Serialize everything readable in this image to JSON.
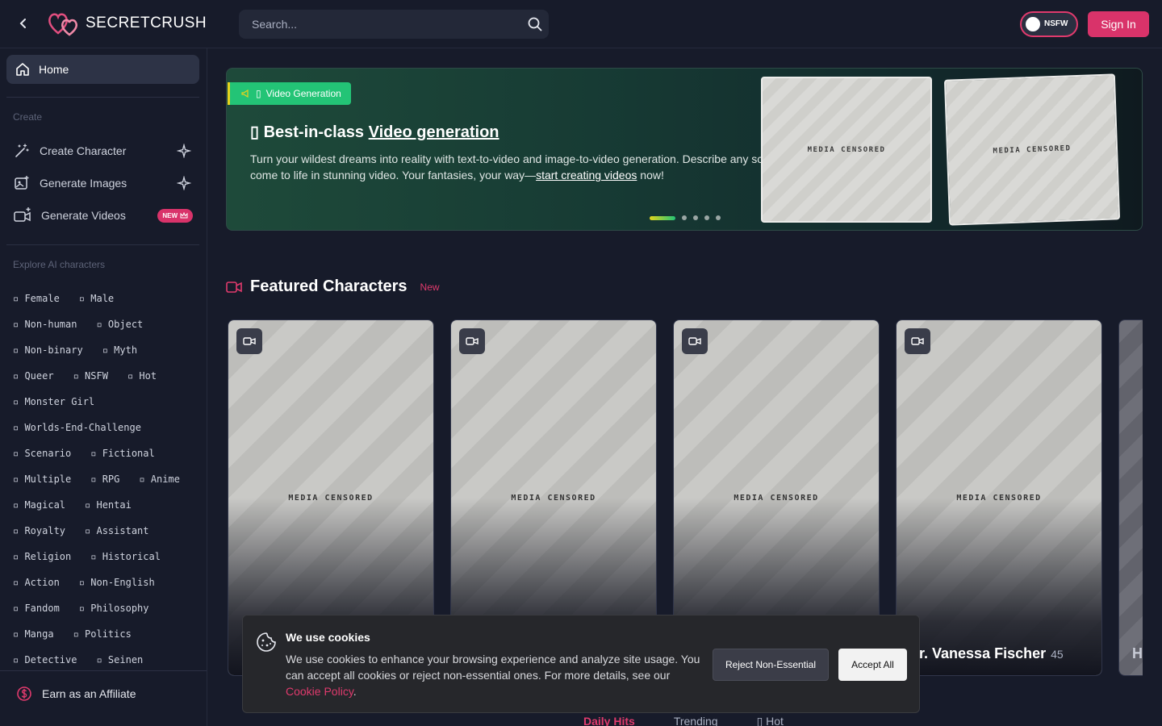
{
  "header": {
    "logo_text": "SECRETCRUSH",
    "search_placeholder": "Search...",
    "nsfw_label": "NSFW",
    "sign_in": "Sign In"
  },
  "sidebar": {
    "home": "Home",
    "create_label": "Create",
    "create_items": [
      {
        "label": "Create Character"
      },
      {
        "label": "Generate Images"
      },
      {
        "label": "Generate Videos",
        "badge": "NEW"
      }
    ],
    "explore_label": "Explore AI characters",
    "tag_rows": [
      [
        "Female",
        "Male"
      ],
      [
        "Non-human",
        "Object"
      ],
      [
        "Non-binary",
        "Myth"
      ],
      [
        "Queer",
        "NSFW",
        "Hot"
      ],
      [
        "Monster Girl"
      ],
      [
        "Worlds-End-Challenge"
      ],
      [
        "Scenario",
        "Fictional"
      ],
      [
        "Multiple",
        "RPG",
        "Anime"
      ],
      [
        "Magical",
        "Hentai"
      ],
      [
        "Royalty",
        "Assistant"
      ],
      [
        "Religion",
        "Historical"
      ],
      [
        "Action",
        "Non-English"
      ],
      [
        "Fandom",
        "Philosophy"
      ],
      [
        "Manga",
        "Politics"
      ],
      [
        "Detective",
        "Seinen"
      ]
    ],
    "affiliate": "Earn as an Affiliate"
  },
  "banner": {
    "tag": "Video Generation",
    "title_prefix": "Best-in-class ",
    "title_link": "Video generation",
    "desc_1": "Turn your wildest dreams into reality with text-to-video and image-to-video generation. Describe any scene and watch it",
    "desc_2": "come to life in stunning video. Your fantasies, your way—",
    "desc_link": "start creating videos",
    "desc_3": " now!",
    "media_label": "MEDIA CENSORED",
    "slide_count": 5,
    "active_slide": 0
  },
  "featured": {
    "title": "Featured Characters",
    "badge": "New",
    "cards": [
      {
        "media": "MEDIA CENSORED"
      },
      {
        "media": "MEDIA CENSORED"
      },
      {
        "media": "MEDIA CENSORED"
      },
      {
        "media": "MEDIA CENSORED",
        "name": "r. Vanessa Fischer",
        "age": "45"
      }
    ],
    "partial_card_letter": "H"
  },
  "tabs": [
    "Daily Hits",
    "Trending",
    "Hot"
  ],
  "cookie": {
    "title": "We use cookies",
    "text": "We use cookies to enhance your browsing experience and analyze site usage. You can accept all cookies or reject non-essential ones. For more details, see our ",
    "link": "Cookie Policy",
    "reject": "Reject Non-Essential",
    "accept": "Accept All"
  },
  "colors": {
    "accent": "#d9336a",
    "background": "#171b2a",
    "banner_tag": "#23c476"
  }
}
